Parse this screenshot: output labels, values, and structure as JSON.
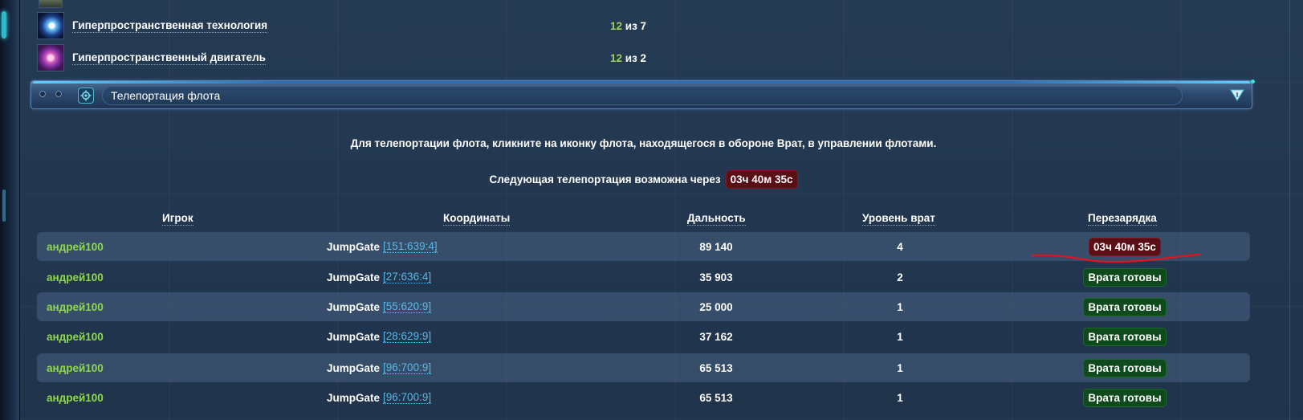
{
  "tech_list": [
    {
      "name": "Гиперпространственная технология",
      "level": "12",
      "of_text": "из 7",
      "icon": "hyperspace-tech-icon"
    },
    {
      "name": "Гиперпространственный двигатель",
      "level": "12",
      "of_text": "из 2",
      "icon": "hyperspace-drive-icon"
    }
  ],
  "section": {
    "title": "Телепортация флота",
    "icons": {
      "settings": "gear-icon",
      "collapse": "chevron-down-icon"
    }
  },
  "info_text": "Для телепортации флота, кликните на иконку флота, находящегося в обороне Врат, в управлении флотами.",
  "next_teleport": {
    "label": "Следующая телепортация возможна через",
    "timer": "03ч 40м 35с"
  },
  "table": {
    "headers": {
      "player": "Игрок",
      "coords": "Координаты",
      "distance": "Дальность",
      "gate_level": "Уровень врат",
      "recharge": "Перезарядка"
    },
    "rows": [
      {
        "player": "андрей100",
        "gate": "JumpGate",
        "coords": "[151:639:4]",
        "distance": "89 140",
        "level": "4",
        "recharge": "03ч 40м 35с",
        "status": "cooldown"
      },
      {
        "player": "андрей100",
        "gate": "JumpGate",
        "coords": "[27:636:4]",
        "distance": "35 903",
        "level": "2",
        "recharge": "Врата готовы",
        "status": "ready"
      },
      {
        "player": "андрей100",
        "gate": "JumpGate",
        "coords": "[55:620:9]",
        "distance": "25 000",
        "level": "1",
        "recharge": "Врата готовы",
        "status": "ready"
      },
      {
        "player": "андрей100",
        "gate": "JumpGate",
        "coords": "[28:629:9]",
        "distance": "37 162",
        "level": "1",
        "recharge": "Врата готовы",
        "status": "ready"
      },
      {
        "player": "андрей100",
        "gate": "JumpGate",
        "coords": "[96:700:9]",
        "distance": "65 513",
        "level": "1",
        "recharge": "Врата готовы",
        "status": "ready"
      },
      {
        "player": "андрей100",
        "gate": "JumpGate",
        "coords": "[96:700:9]",
        "distance": "65 513",
        "level": "1",
        "recharge": "Врата готовы",
        "status": "ready"
      }
    ]
  },
  "colors": {
    "background": "#213650",
    "player_green": "#8fd94a",
    "coords_blue": "#5ab8e6",
    "timer_red": "#5a0e15",
    "ready_green": "#0e4a1c",
    "level_green": "#9ed15a"
  }
}
